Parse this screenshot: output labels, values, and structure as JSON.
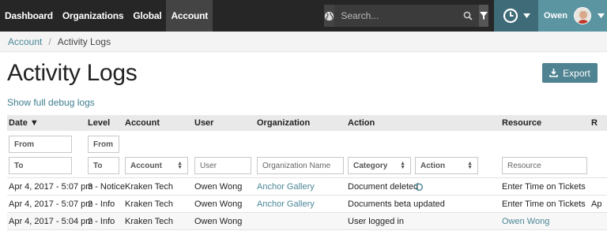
{
  "nav": {
    "links": [
      "Dashboard",
      "Organizations",
      "Global",
      "Account"
    ],
    "search_placeholder": "Search...",
    "user_name": "Owen"
  },
  "breadcrumb": {
    "parent": "Account",
    "separator": "/",
    "current": "Activity Logs"
  },
  "page": {
    "title": "Activity Logs",
    "export_label": "Export",
    "debug_link": "Show full debug logs"
  },
  "table": {
    "headers": [
      "Date ▼",
      "Level",
      "Account",
      "User",
      "Organization",
      "Action",
      "Resource",
      "R"
    ],
    "filters": {
      "date_from": "From",
      "date_to": "To",
      "level_from": "From",
      "level_to": "To",
      "account": "Account",
      "user": "User",
      "organization": "Organization Name",
      "category": "Category",
      "action": "Action",
      "resource": "Resource"
    },
    "rows": [
      {
        "date": "Apr 4, 2017 - 5:07 pm",
        "level": "3 - Notice",
        "account": "Kraken Tech",
        "user": "Owen Wong",
        "organization": "Anchor Gallery",
        "action": "Document deleted",
        "resource": "Enter Time on Tickets",
        "extra": ""
      },
      {
        "date": "Apr 4, 2017 - 5:07 pm",
        "level": "2 - Info",
        "account": "Kraken Tech",
        "user": "Owen Wong",
        "organization": "Anchor Gallery",
        "action": "Documents beta updated",
        "resource": "Enter Time on Tickets",
        "extra": "Ap"
      },
      {
        "date": "Apr 4, 2017 - 5:04 pm",
        "level": "2 - Info",
        "account": "Kraken Tech",
        "user": "Owen Wong",
        "organization": "",
        "action": "User logged in",
        "resource": "Owen Wong",
        "extra": ""
      }
    ]
  },
  "colors": {
    "navbar": "#262626",
    "accent": "#4f8391",
    "user_menu": "#5b95a2",
    "link": "#4a8797"
  }
}
